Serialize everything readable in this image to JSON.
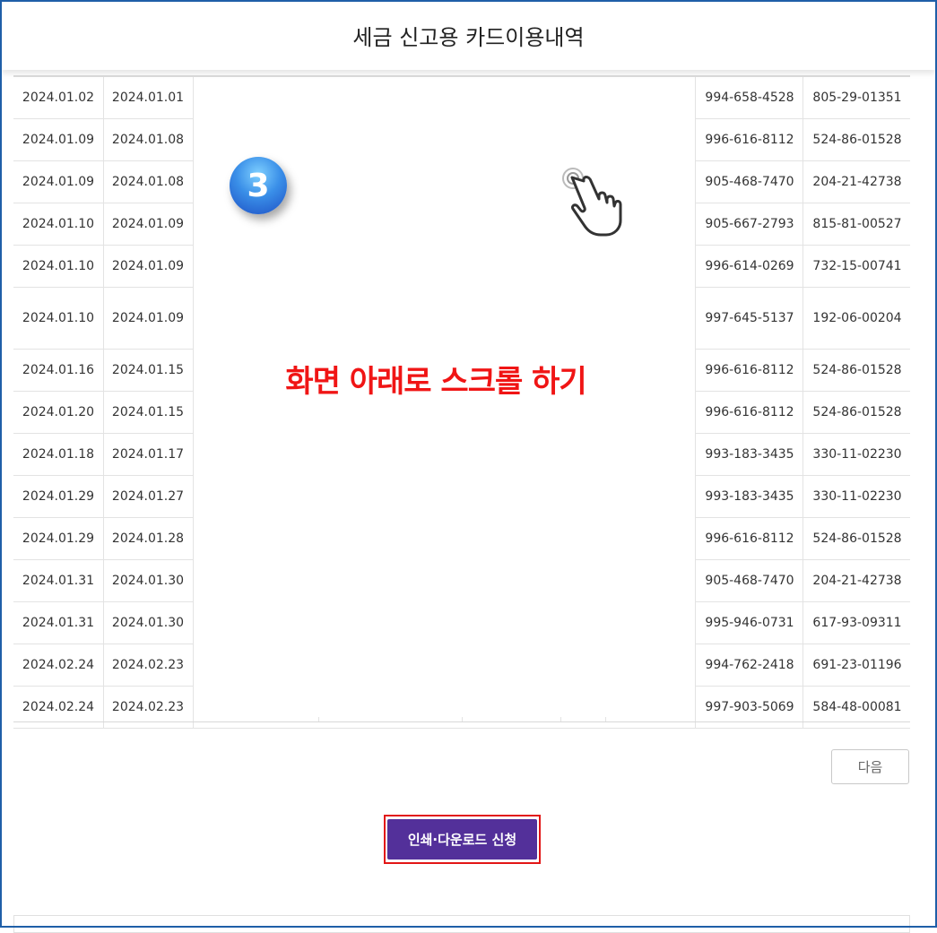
{
  "header": {
    "title": "세금 신고용 카드이용내역"
  },
  "table": {
    "rows": [
      {
        "c1": "2024.01.02",
        "c2": "2024.01.01",
        "c3": "994-658-4528",
        "c4": "805-29-01351"
      },
      {
        "c1": "2024.01.09",
        "c2": "2024.01.08",
        "c3": "996-616-8112",
        "c4": "524-86-01528"
      },
      {
        "c1": "2024.01.09",
        "c2": "2024.01.08",
        "c3": "905-468-7470",
        "c4": "204-21-42738"
      },
      {
        "c1": "2024.01.10",
        "c2": "2024.01.09",
        "c3": "905-667-2793",
        "c4": "815-81-00527"
      },
      {
        "c1": "2024.01.10",
        "c2": "2024.01.09",
        "c3": "996-614-0269",
        "c4": "732-15-00741"
      },
      {
        "c1": "2024.01.10",
        "c2": "2024.01.09",
        "c3": "997-645-5137",
        "c4": "192-06-00204"
      },
      {
        "c1": "2024.01.16",
        "c2": "2024.01.15",
        "c3": "996-616-8112",
        "c4": "524-86-01528"
      },
      {
        "c1": "2024.01.20",
        "c2": "2024.01.15",
        "c3": "996-616-8112",
        "c4": "524-86-01528"
      },
      {
        "c1": "2024.01.18",
        "c2": "2024.01.17",
        "c3": "993-183-3435",
        "c4": "330-11-02230"
      },
      {
        "c1": "2024.01.29",
        "c2": "2024.01.27",
        "c3": "993-183-3435",
        "c4": "330-11-02230"
      },
      {
        "c1": "2024.01.29",
        "c2": "2024.01.28",
        "c3": "996-616-8112",
        "c4": "524-86-01528"
      },
      {
        "c1": "2024.01.31",
        "c2": "2024.01.30",
        "c3": "905-468-7470",
        "c4": "204-21-42738"
      },
      {
        "c1": "2024.01.31",
        "c2": "2024.01.30",
        "c3": "995-946-0731",
        "c4": "617-93-09311"
      },
      {
        "c1": "2024.02.24",
        "c2": "2024.02.23",
        "c3": "994-762-2418",
        "c4": "691-23-01196"
      },
      {
        "c1": "2024.02.24",
        "c2": "2024.02.23",
        "c3": "997-903-5069",
        "c4": "584-48-00081"
      }
    ]
  },
  "overlay": {
    "step_number": "3",
    "instruction": "화면 아래로 스크롤 하기",
    "hand_icon": "pointing-hand-tap-icon",
    "instruction_color": "#f01515"
  },
  "pagination": {
    "next_label": "다음"
  },
  "actions": {
    "print_download_label": "인쇄·다운로드 신청",
    "button_color": "#53309a",
    "highlight_color": "#e21616"
  }
}
